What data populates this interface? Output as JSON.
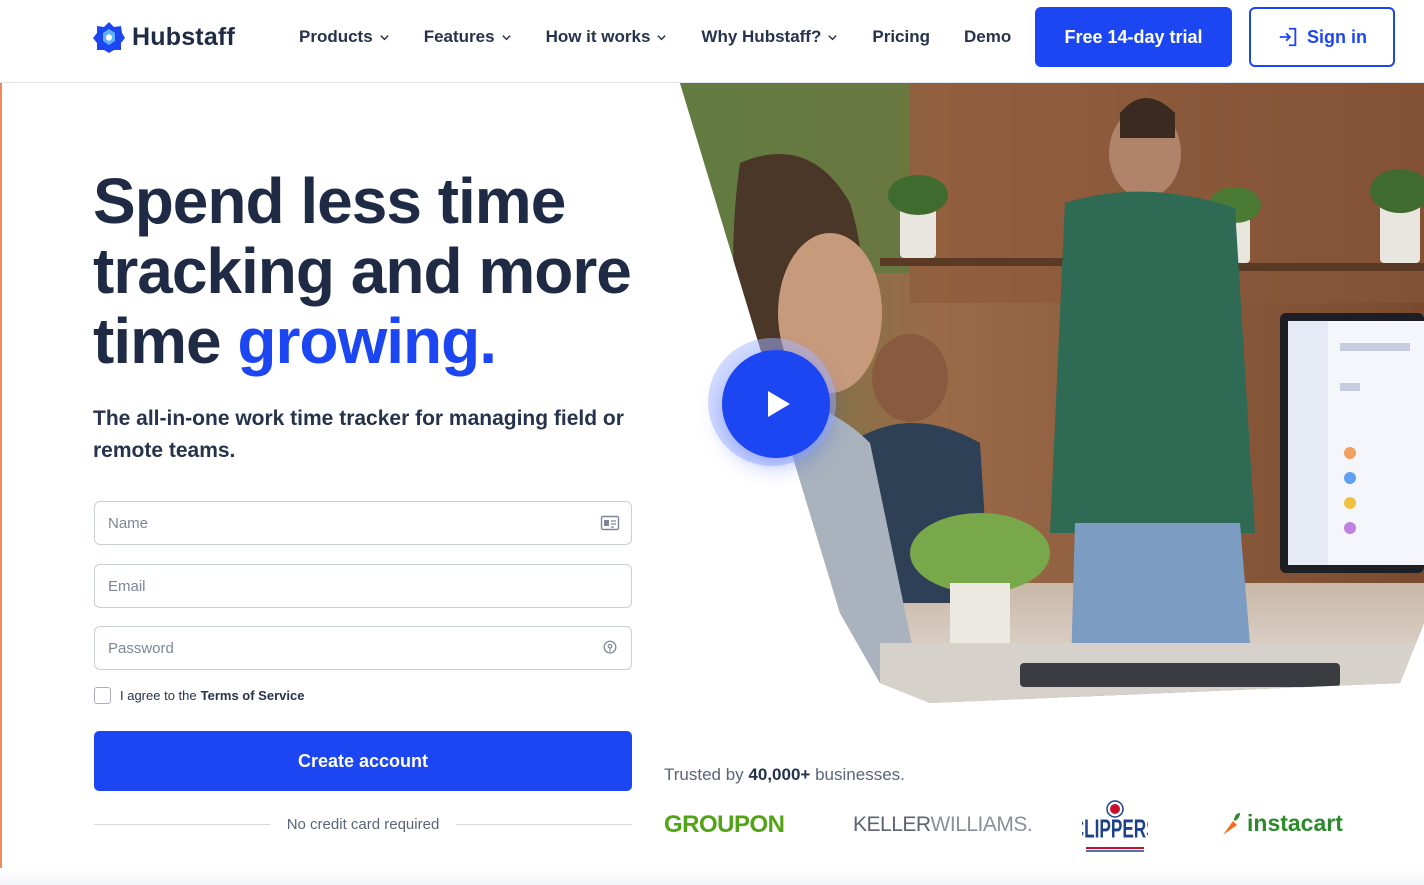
{
  "header": {
    "brand": "Hubstaff",
    "nav": [
      {
        "label": "Products",
        "has_dropdown": true
      },
      {
        "label": "Features",
        "has_dropdown": true
      },
      {
        "label": "How it works",
        "has_dropdown": true
      },
      {
        "label": "Why Hubstaff?",
        "has_dropdown": true
      },
      {
        "label": "Pricing",
        "has_dropdown": false
      },
      {
        "label": "Demo",
        "has_dropdown": false
      }
    ],
    "trial_button": "Free 14-day trial",
    "signin_button": "Sign in"
  },
  "hero": {
    "headline_line1": "Spend less time",
    "headline_line2": "tracking and more",
    "headline_line3_start": "time ",
    "headline_accent": "growing.",
    "subheadline": "The all-in-one work time tracker for managing field or remote teams."
  },
  "form": {
    "name_placeholder": "Name",
    "email_placeholder": "Email",
    "password_placeholder": "Password",
    "agree_text": "I agree to the",
    "terms_link": "Terms of Service",
    "agree_checked": false,
    "submit_button": "Create account",
    "note": "No credit card required"
  },
  "video": {
    "play_icon": "play-icon"
  },
  "trust": {
    "prefix": "Trusted by",
    "count": "40,000+",
    "suffix": "businesses.",
    "logos": {
      "groupon": "GROUPON",
      "keller_a": "KELLER",
      "keller_b": "WILLIAMS.",
      "clippers": "CLIPPERS",
      "instacart": "instacart"
    }
  },
  "colors": {
    "primary": "#1c46f2",
    "text": "#1f2a44",
    "groupon": "#53a318",
    "instacart": "#2c8a2c",
    "clippers_red": "#c8102e",
    "clippers_blue": "#1d428a"
  }
}
